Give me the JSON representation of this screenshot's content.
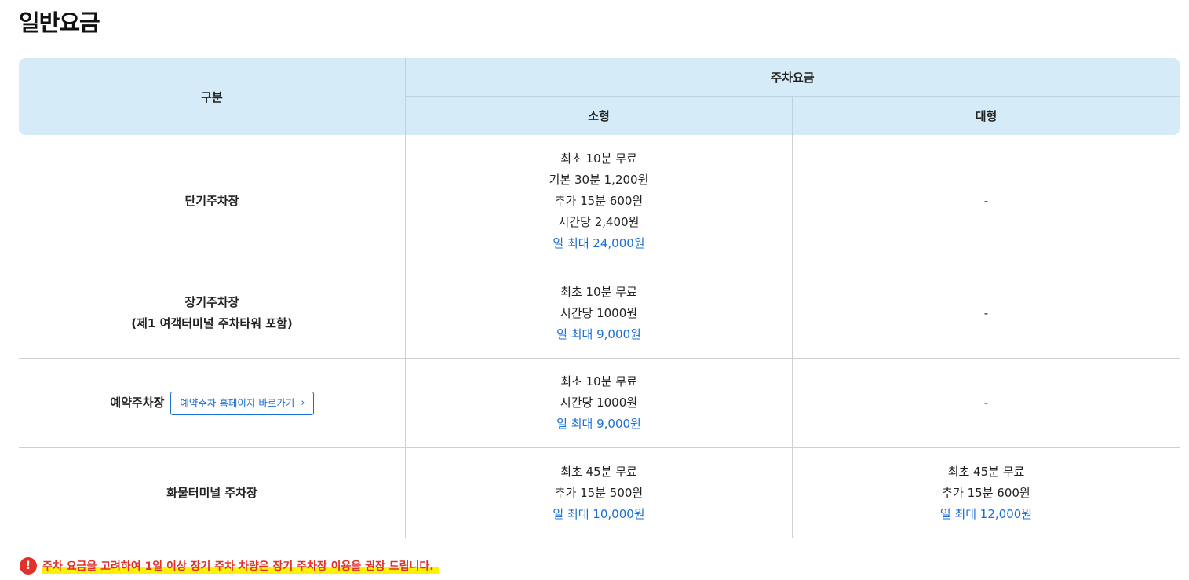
{
  "page_title": "일반요금",
  "table": {
    "header": {
      "division": "구분",
      "fee": "주차요금",
      "small": "소형",
      "large": "대형"
    },
    "rows": [
      {
        "name_lines": [
          "단기주차장"
        ],
        "small": [
          "최초 10분 무료",
          "기본 30분 1,200원",
          "추가 15분 600원",
          "시간당 2,400원"
        ],
        "small_max": "일 최대 24,000원",
        "large": [
          "-"
        ],
        "large_max": ""
      },
      {
        "name_lines": [
          "장기주차장",
          "(제1 여객터미널 주차타워 포함)"
        ],
        "small": [
          "최초 10분 무료",
          "시간당 1000원"
        ],
        "small_max": "일 최대 9,000원",
        "large": [
          "-"
        ],
        "large_max": ""
      },
      {
        "name_lines": [
          "예약주차장"
        ],
        "link_label": "예약주차 홈페이지 바로가기",
        "link_icon": "chevron-right-icon",
        "small": [
          "최초 10분 무료",
          "시간당 1000원"
        ],
        "small_max": "일 최대 9,000원",
        "large": [
          "-"
        ],
        "large_max": ""
      },
      {
        "name_lines": [
          "화물터미널 주차장"
        ],
        "small": [
          "최초 45분 무료",
          "추가 15분 500원"
        ],
        "small_max": "일 최대 10,000원",
        "large": [
          "최초 45분 무료",
          "추가 15분 600원"
        ],
        "large_max": "일 최대 12,000원"
      }
    ]
  },
  "notice": {
    "icon": "exclamation-icon",
    "text": "주차 요금을 고려하여 1일 이상 장기 주차 차량은 장기 주차장 이용을 권장 드립니다."
  },
  "colors": {
    "header_bg": "#d5ebf7",
    "max_fee": "#1a6fd4",
    "notice": "#e0312a",
    "highlight": "#fff200"
  }
}
